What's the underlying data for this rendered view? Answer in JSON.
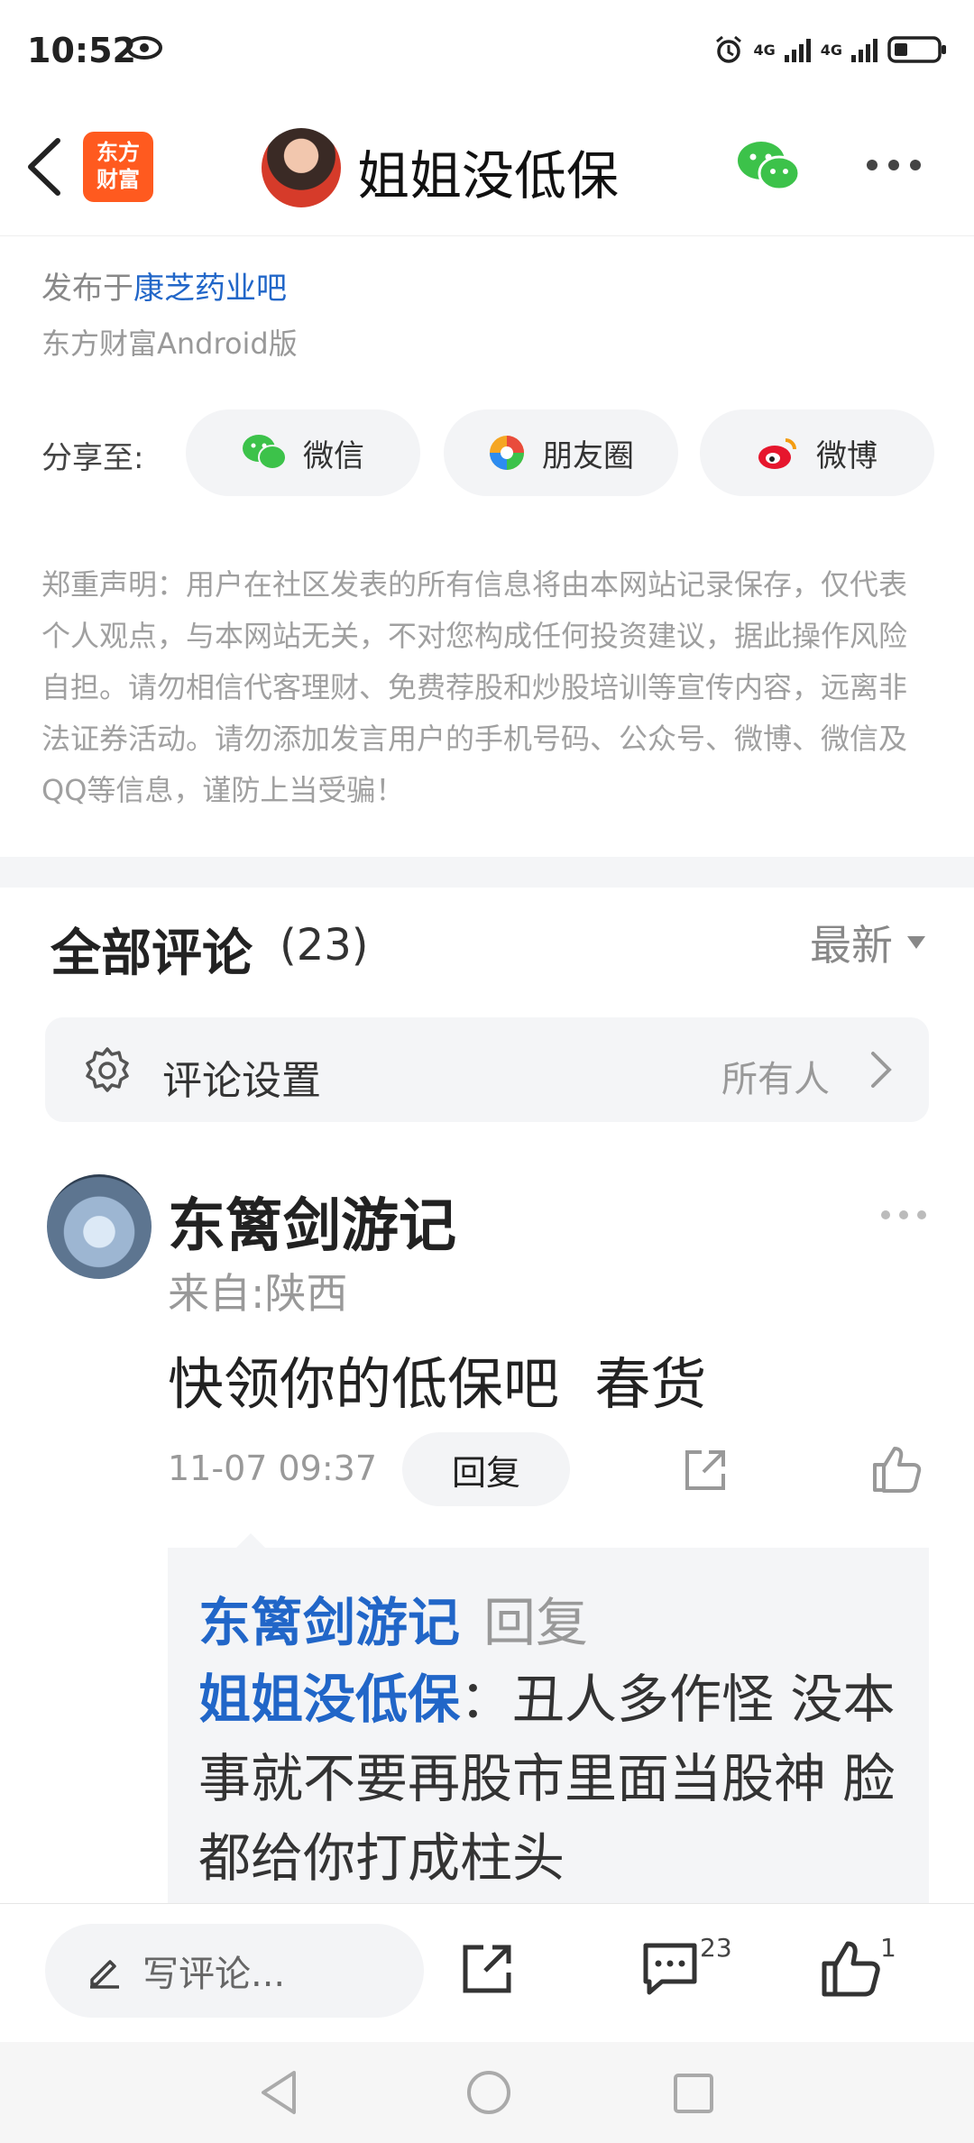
{
  "status_bar": {
    "time": "10:52",
    "network1": "4G",
    "network2": "4G"
  },
  "header": {
    "app_logo_line1": "东方",
    "app_logo_line2": "财富",
    "title": "姐姐没低保"
  },
  "post": {
    "origin_prefix": "发布于",
    "origin_link": "康芝药业吧",
    "platform": "东方财富Android版"
  },
  "share": {
    "label": "分享至:",
    "wechat": "微信",
    "moments": "朋友圈",
    "weibo": "微博"
  },
  "disclaimer": "郑重声明：用户在社区发表的所有信息将由本网站记录保存，仅代表个人观点，与本网站无关，不对您构成任何投资建议，据此操作风险自担。请勿相信代客理财、免费荐股和炒股培训等宣传内容，远离非法证券活动。请勿添加发言用户的手机号码、公众号、微博、微信及QQ等信息，谨防上当受骗！",
  "comments": {
    "title": "全部评论",
    "count": "(23)",
    "sort": "最新",
    "settings_label": "评论设置",
    "settings_value": "所有人",
    "items": [
      {
        "user": "东篱剑游记",
        "location": "来自:陕西",
        "text": "快领你的低保吧  春货",
        "time": "11-07 09:37",
        "reply_label": "回复",
        "reply": {
          "user": "东篱剑游记",
          "word": "回复",
          "target": "姐姐没低保",
          "text": "：丑人多作怪  没本事就不要再股市里面当股神  脸都给你打成柱头"
        }
      }
    ]
  },
  "bottom_bar": {
    "write_placeholder": "写评论...",
    "comment_count": "23",
    "like_count": "1"
  },
  "colors": {
    "link": "#2166c8",
    "brand": "#ff5a1f",
    "wechat": "#3cc24a"
  }
}
